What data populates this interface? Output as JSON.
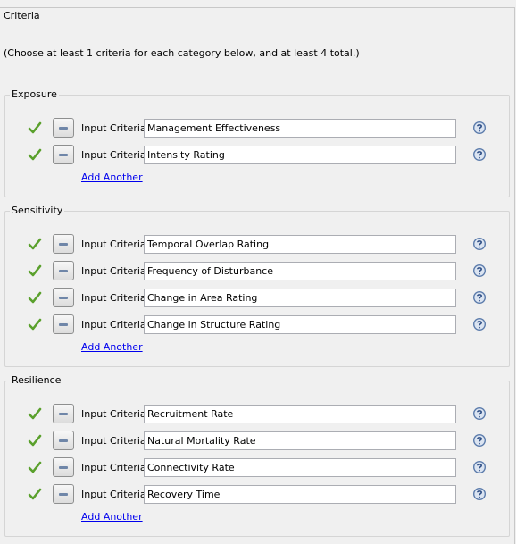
{
  "criteria": {
    "title": "Criteria",
    "instructions": "(Choose at least 1 criteria for each category below, and at least 4 total.)",
    "input_label": "Input Criteria",
    "add_label": "Add Another",
    "sections": [
      {
        "title": "Exposure",
        "rows": [
          "Management Effectiveness",
          "Intensity Rating"
        ]
      },
      {
        "title": "Sensitivity",
        "rows": [
          "Temporal Overlap Rating",
          "Frequency of Disturbance",
          "Change in Area Rating",
          "Change in Structure Rating"
        ]
      },
      {
        "title": "Resilience",
        "rows": [
          "Recruitment Rate",
          "Natural Mortality Rate",
          "Connectivity Rate",
          "Recovery Time"
        ]
      }
    ]
  },
  "icons": {
    "check": "check-icon",
    "remove": "minus-icon",
    "help": "question-mark-icon"
  },
  "colors": {
    "check_green": "#5aa02c",
    "help_blue": "#5b7bab",
    "link_blue": "#0000ee"
  }
}
